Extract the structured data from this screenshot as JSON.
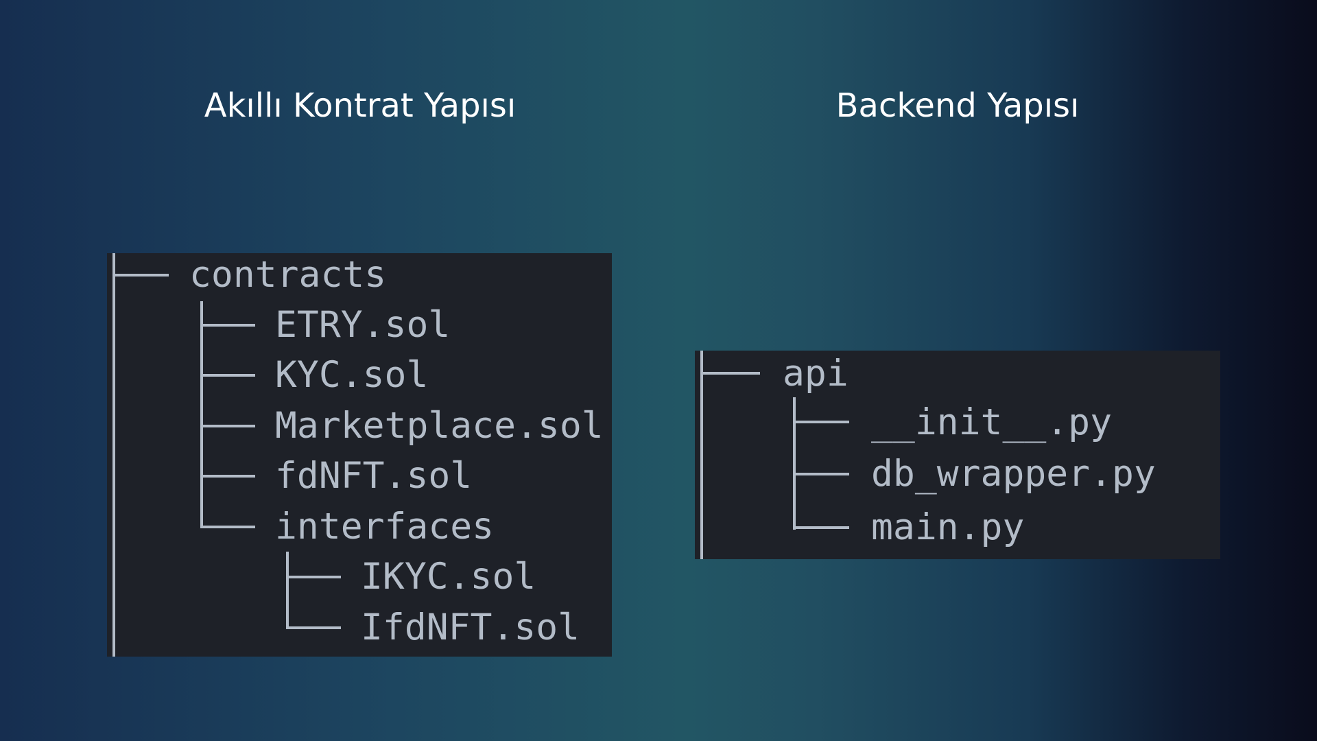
{
  "headings": {
    "left": "Akıllı Kontrat Yapısı",
    "right": "Backend Yapısı"
  },
  "contracts_tree": {
    "root": "contracts",
    "files": [
      "ETRY.sol",
      "KYC.sol",
      "Marketplace.sol",
      "fdNFT.sol"
    ],
    "subfolder": "interfaces",
    "subfolder_files": [
      "IKYC.sol",
      "IfdNFT.sol"
    ]
  },
  "backend_tree": {
    "root": "api",
    "files": [
      "__init__.py",
      "db_wrapper.py",
      "main.py"
    ]
  },
  "colors": {
    "panel_background": "#1e2128",
    "tree_text": "#b3bcc8",
    "heading_text": "#ffffff"
  }
}
